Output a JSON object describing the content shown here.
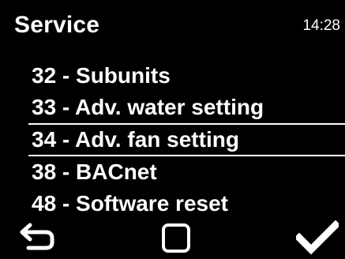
{
  "header": {
    "title": "Service",
    "clock": "14:28"
  },
  "menu": {
    "items": [
      {
        "label": "32 - Subunits"
      },
      {
        "label": "33 - Adv. water setting"
      },
      {
        "label": "34 - Adv. fan setting",
        "selected": true
      },
      {
        "label": "38 - BACnet"
      },
      {
        "label": "48 - Software reset"
      }
    ]
  },
  "footer": {
    "back_icon": "back-arrow-icon",
    "home_icon": "square-icon",
    "ok_icon": "checkmark-icon"
  },
  "colors": {
    "background": "#000000",
    "foreground": "#ffffff"
  }
}
